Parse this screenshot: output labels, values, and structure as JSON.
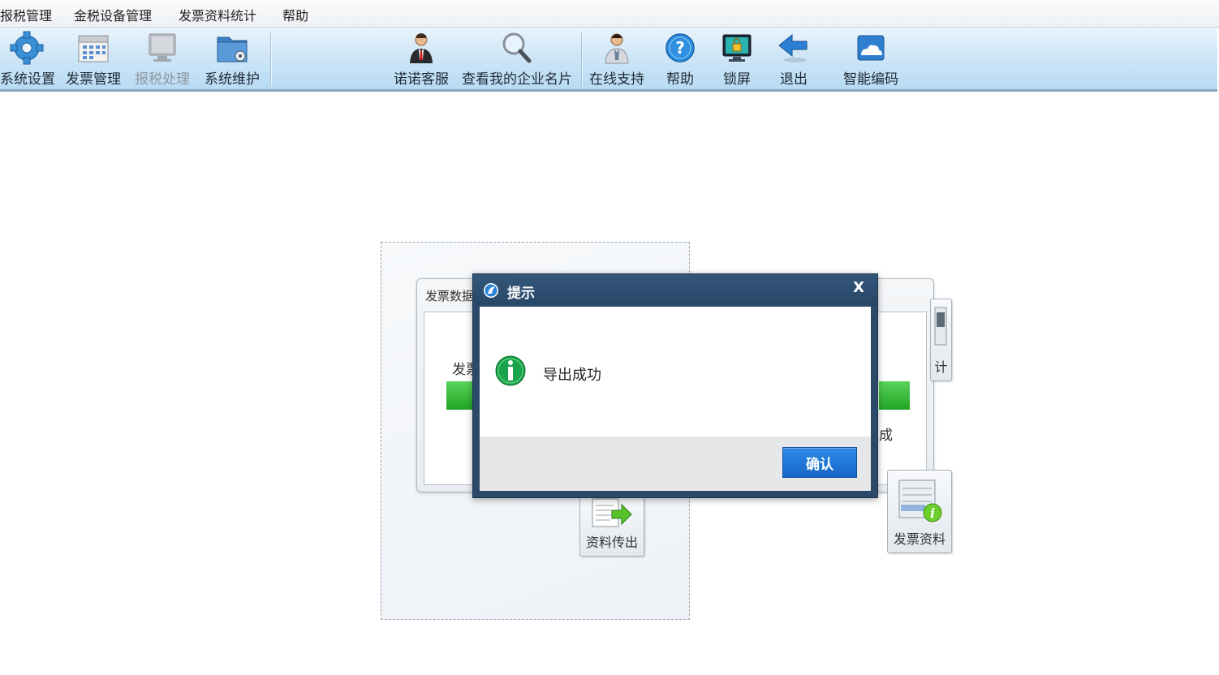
{
  "menu": {
    "items": [
      "报税管理",
      "金税设备管理",
      "发票资料统计",
      "帮助"
    ]
  },
  "toolbar": {
    "items": [
      {
        "label": "系统设置",
        "icon": "gear-icon"
      },
      {
        "label": "发票管理",
        "icon": "invoice-calendar-icon"
      },
      {
        "label": "报税处理",
        "icon": "monitor-icon",
        "disabled": true
      },
      {
        "label": "系统维护",
        "icon": "folder-gear-icon"
      },
      {
        "label": "诺诺客服",
        "icon": "agent-person-icon"
      },
      {
        "label": "查看我的企业名片",
        "icon": "magnifier-icon"
      },
      {
        "label": "在线支持",
        "icon": "support-person-icon"
      },
      {
        "label": "帮助",
        "icon": "help-question-icon"
      },
      {
        "label": "锁屏",
        "icon": "lock-screen-icon"
      },
      {
        "label": "退出",
        "icon": "exit-arrow-icon"
      },
      {
        "label": "智能编码",
        "icon": "cloud-code-icon"
      }
    ]
  },
  "background": {
    "window_title": "发票数据",
    "left_label": "发票",
    "right_label": "成",
    "tile_right_top_label": "计",
    "tile_export_label": "资料传出",
    "tile_invoice_label": "发票资料"
  },
  "dialog": {
    "title": "提示",
    "close_label": "X",
    "message": "导出成功",
    "confirm_label": "确认"
  },
  "colors": {
    "dialog_frame": "#2b4a6a",
    "confirm_button": "#1e78d8",
    "progress_green": "#2db52f",
    "toolbar_blue": "#cfe6f7"
  }
}
